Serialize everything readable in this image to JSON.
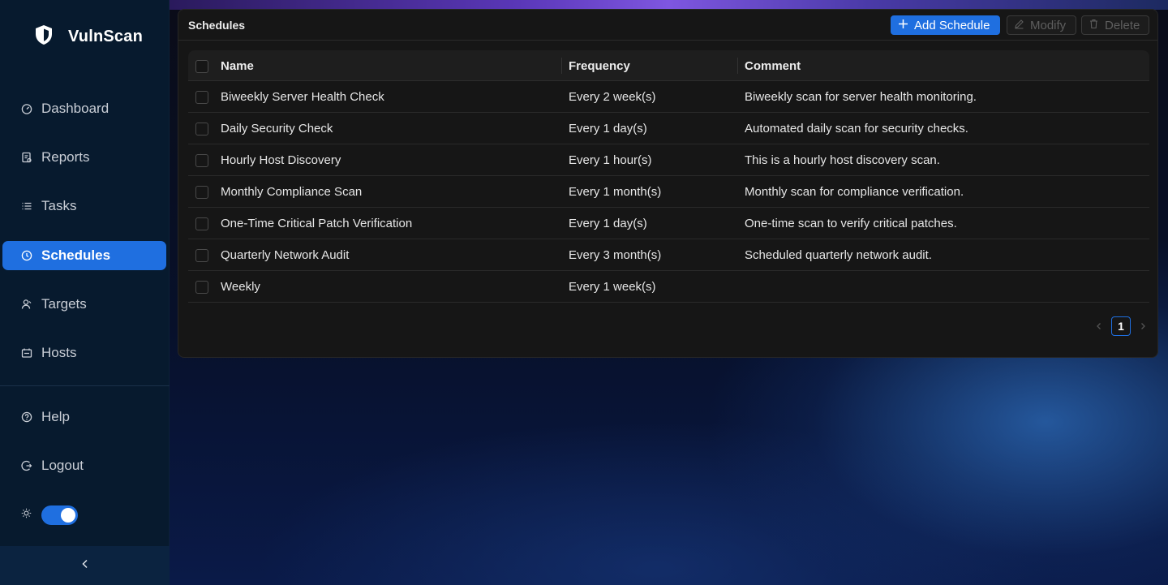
{
  "app": {
    "name": "VulnScan"
  },
  "sidebar": {
    "items": [
      {
        "label": "Dashboard",
        "icon": "dashboard-icon"
      },
      {
        "label": "Reports",
        "icon": "reports-icon"
      },
      {
        "label": "Tasks",
        "icon": "tasks-icon"
      },
      {
        "label": "Schedules",
        "icon": "clock-icon",
        "active": true
      },
      {
        "label": "Targets",
        "icon": "targets-icon"
      },
      {
        "label": "Hosts",
        "icon": "hosts-icon"
      }
    ],
    "bottom_items": [
      {
        "label": "Help",
        "icon": "help-icon"
      },
      {
        "label": "Logout",
        "icon": "logout-icon"
      }
    ],
    "theme_toggle": {
      "icon": "sun-icon",
      "on": true
    },
    "collapse_icon": "chevron-left-icon"
  },
  "page": {
    "title": "Schedules",
    "actions": {
      "add_label": "Add Schedule",
      "modify_label": "Modify",
      "delete_label": "Delete"
    }
  },
  "table": {
    "columns": [
      "Name",
      "Frequency",
      "Comment"
    ],
    "rows": [
      {
        "name": "Biweekly Server Health Check",
        "frequency": "Every 2 week(s)",
        "comment": "Biweekly scan for server health monitoring."
      },
      {
        "name": "Daily Security Check",
        "frequency": "Every 1 day(s)",
        "comment": "Automated daily scan for security checks."
      },
      {
        "name": "Hourly Host Discovery",
        "frequency": "Every 1 hour(s)",
        "comment": "This is a hourly host discovery scan."
      },
      {
        "name": "Monthly Compliance Scan",
        "frequency": "Every 1 month(s)",
        "comment": "Monthly scan for compliance verification."
      },
      {
        "name": "One-Time Critical Patch Verification",
        "frequency": "Every 1 day(s)",
        "comment": "One-time scan to verify critical patches."
      },
      {
        "name": "Quarterly Network Audit",
        "frequency": "Every 3 month(s)",
        "comment": "Scheduled quarterly network audit."
      },
      {
        "name": "Weekly",
        "frequency": "Every 1 week(s)",
        "comment": ""
      }
    ]
  },
  "pagination": {
    "current_page": "1"
  },
  "colors": {
    "accent": "#1f6fe0",
    "sidebar_bg": "#071a2e",
    "card_bg": "#161616"
  }
}
